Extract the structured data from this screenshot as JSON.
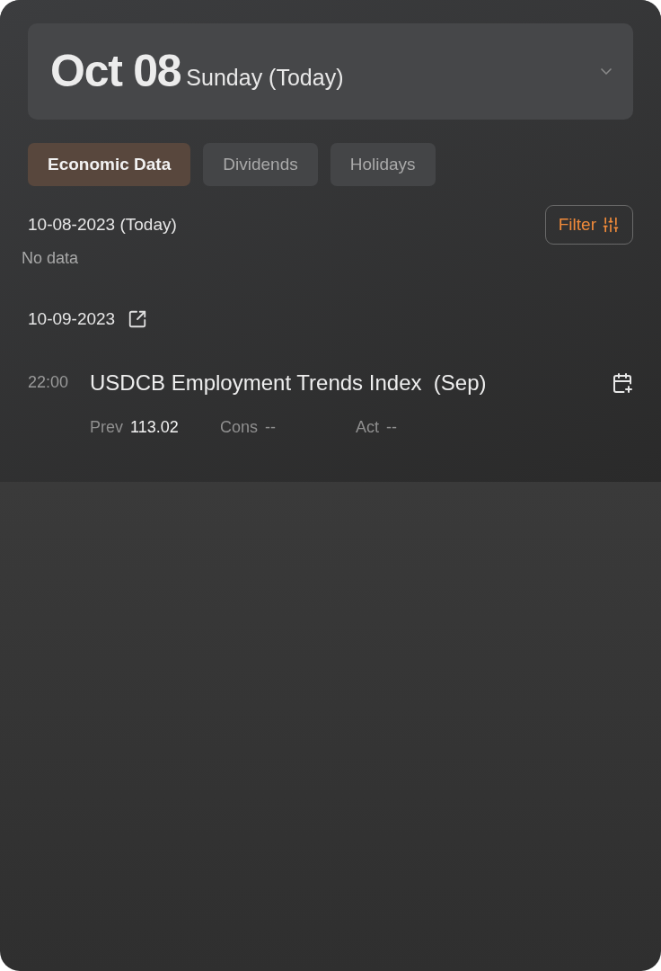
{
  "header": {
    "date": "Oct 08",
    "day": "Sunday (Today)"
  },
  "tabs": [
    {
      "label": "Economic Data",
      "selected": true
    },
    {
      "label": "Dividends",
      "selected": false
    },
    {
      "label": "Holidays",
      "selected": false
    }
  ],
  "filter": {
    "label": "Filter"
  },
  "today": {
    "date": "10-08-2023 (Today)",
    "empty_text": "No data"
  },
  "next_day": {
    "date": "10-09-2023",
    "events": [
      {
        "time": "22:00",
        "title": "USDCB Employment Trends Index  (Sep)",
        "stats": [
          {
            "label": "Prev",
            "value": "113.02",
            "known": true
          },
          {
            "label": "Cons",
            "value": "--",
            "known": false
          },
          {
            "label": "Act",
            "value": "--",
            "known": false
          }
        ]
      }
    ]
  }
}
